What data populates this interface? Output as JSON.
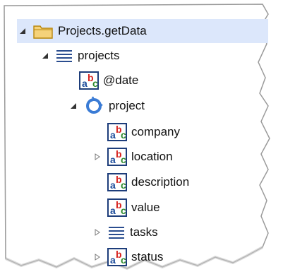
{
  "tree": {
    "root": {
      "label": "Projects.getData",
      "expanded": true,
      "icon": "folder-icon"
    },
    "items": [
      {
        "label": "projects",
        "icon": "list-icon",
        "expander": "expanded"
      },
      {
        "label": "@date",
        "icon": "string-field-icon",
        "expander": "none"
      },
      {
        "label": "project",
        "icon": "cycle-icon",
        "expander": "expanded"
      },
      {
        "label": "company",
        "icon": "string-field-icon",
        "expander": "none"
      },
      {
        "label": "location",
        "icon": "string-field-icon",
        "expander": "collapsed"
      },
      {
        "label": "description",
        "icon": "string-field-icon",
        "expander": "none"
      },
      {
        "label": "value",
        "icon": "string-field-icon",
        "expander": "none"
      },
      {
        "label": "tasks",
        "icon": "list-icon",
        "expander": "collapsed"
      },
      {
        "label": "status",
        "icon": "string-field-icon",
        "expander": "collapsed"
      }
    ]
  },
  "colors": {
    "selection": "#dce7fb",
    "folder": "#f2c14e",
    "list": "#2a4d8f",
    "cycle": "#3a7bd5",
    "abc_border": "#1d3d7a"
  }
}
